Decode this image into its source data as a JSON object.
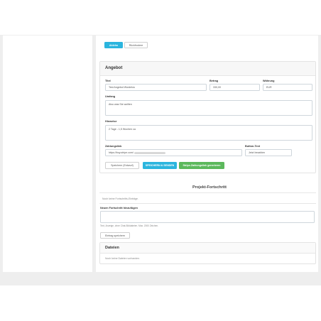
{
  "top_buttons": {
    "primary_label": "Ablehn",
    "secondary_label": "Rückfrodere"
  },
  "angebot": {
    "title": "Angebot",
    "titel_label": "Titel",
    "titel_value": "Test Angebot Wordelos",
    "betrag_label": "Betrag",
    "betrag_value": "330,00",
    "waehrung_label": "Währung",
    "waehrung_value": "EUR",
    "umfang_label": "Umfang",
    "umfang_value": "Also was Sie wollten",
    "hinweise_label": "Hinweise",
    "hinweise_value": "2 Tage - 1,5 Wochen ca",
    "zahlungslink_label": "Zahlungslink",
    "zahlungslink_value": "https://buy.stripe.com/",
    "button_text_label": "Button-Text",
    "button_text_value": "Jetzt bezahlen",
    "save_draft_label": "Speichern (Entwurf)",
    "save_send_label": "SPEICHERN & SENDEN",
    "stripe_label": "Stripe-Zahlungslink generieren"
  },
  "projekt": {
    "title": "Projekt-Fortschritt",
    "empty_text": "Noch keine Fortschritts-Einträge.",
    "new_label": "Neuen Fortschritt hinzufügen",
    "new_value": "",
    "hint": "Text, Anzeige, ohne Chat-Bilddateien. Max. 2000 Zeichen.",
    "save_label": "Eintrag speichern"
  },
  "dateien": {
    "title": "Dateien",
    "empty_text": "Noch keine Dateien vorhanden."
  },
  "colors": {
    "accent": "#2bb5de",
    "success": "#5cb85c",
    "background": "#eeeeee"
  }
}
